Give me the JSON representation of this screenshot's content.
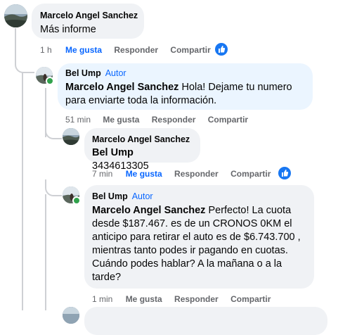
{
  "comments": [
    {
      "author": "Marcelo Angel Sanchez",
      "text": "Más informe",
      "time": "1 h",
      "like": "Me gusta",
      "reply": "Responder",
      "share": "Compartir"
    },
    {
      "author": "Bel Ump",
      "badge": "Autor",
      "mention": "Marcelo Angel Sanchez",
      "text": " Hola! Dejame tu numero para enviarte toda la información.",
      "time": "51 min",
      "like": "Me gusta",
      "reply": "Responder",
      "share": "Compartir"
    },
    {
      "author": "Marcelo Angel Sanchez",
      "mention": "Bel Ump",
      "text": " 3434613305",
      "time": "7 min",
      "like": "Me gusta",
      "reply": "Responder",
      "share": "Compartir"
    },
    {
      "author": "Bel Ump",
      "badge": "Autor",
      "mention": "Marcelo Angel Sanchez",
      "text": " Perfecto! La cuota desde $187.467. es de un CRONOS 0KM el anticipo para retirar el auto es de $6.743.700 , mientras tanto podes ir pagando en cuotas. Cuándo podes hablar? A la mañana o a la tarde?",
      "time": "1 min",
      "like": "Me gusta",
      "reply": "Responder",
      "share": "Compartir"
    }
  ],
  "colors": {
    "accent": "#0866ff",
    "bubble": "#f0f2f5",
    "bubble_highlight": "#ebf5ff",
    "online": "#31a24c"
  },
  "icons": {
    "reaction": "like-icon",
    "presence": "online-dot"
  }
}
